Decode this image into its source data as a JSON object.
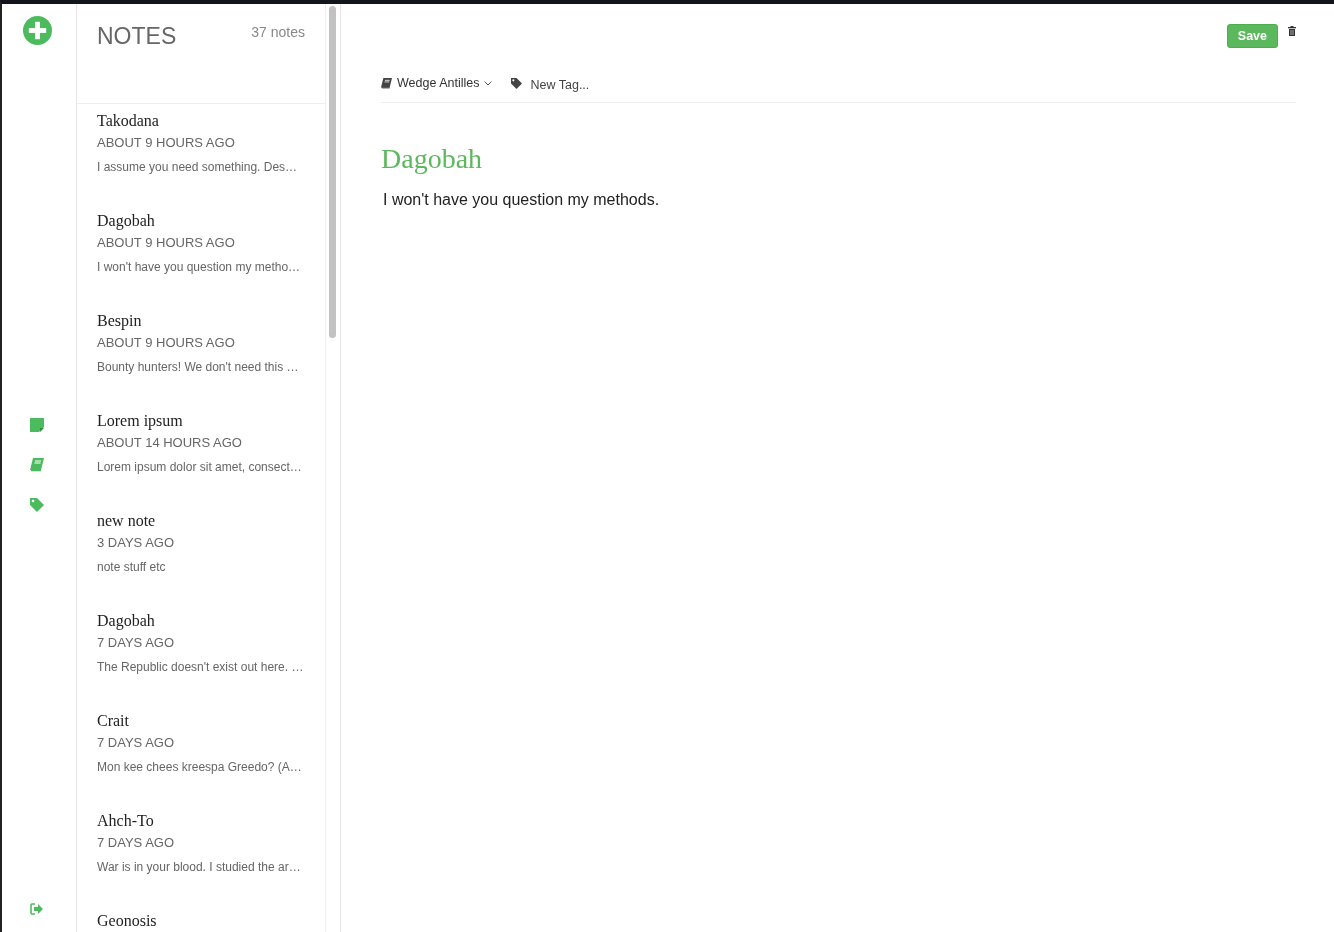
{
  "notes_panel": {
    "title": "NOTES",
    "count": "37 notes"
  },
  "notes": [
    {
      "title": "Takodana",
      "time": "ABOUT 9 HOURS AGO",
      "preview": "I assume you need something. Des…"
    },
    {
      "title": "Dagobah",
      "time": "ABOUT 9 HOURS AGO",
      "preview": "I won't have you question my metho…"
    },
    {
      "title": "Bespin",
      "time": "ABOUT 9 HOURS AGO",
      "preview": "Bounty hunters! We don't need this …"
    },
    {
      "title": "Lorem ipsum",
      "time": "ABOUT 14 HOURS AGO",
      "preview": "Lorem ipsum dolor sit amet, consect…"
    },
    {
      "title": "new note",
      "time": "3 DAYS AGO",
      "preview": "note stuff etc"
    },
    {
      "title": "Dagobah",
      "time": "7 DAYS AGO",
      "preview": "The Republic doesn't exist out here. …"
    },
    {
      "title": "Crait",
      "time": "7 DAYS AGO",
      "preview": "Mon kee chees kreespa Greedo? (A…"
    },
    {
      "title": "Ahch-To",
      "time": "7 DAYS AGO",
      "preview": "War is in your blood. I studied the ar…"
    },
    {
      "title": "Geonosis"
    }
  ],
  "editor": {
    "save_button": "Save",
    "notebook": "Wedge Antilles",
    "tag_field": {
      "placeholder": "New Tag..."
    },
    "title": "Dagobah",
    "body": "I won't have you question my methods."
  }
}
